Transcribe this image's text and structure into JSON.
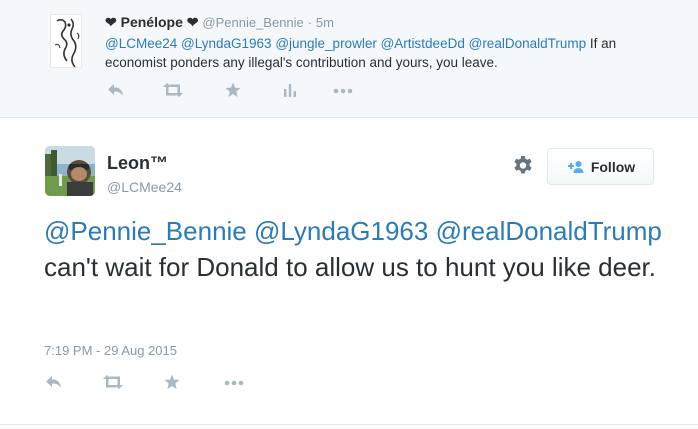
{
  "parent_tweet": {
    "name": "Penélope",
    "heart_glyph": "❤",
    "handle": "@Pennie_Bennie",
    "separator": "·",
    "time": "5m",
    "mentions": [
      "@LCMee24",
      "@LyndaG1963",
      "@jungle_prowler",
      "@ArtistdeeDd",
      "@realDonaldTrump"
    ],
    "text": "If an economist ponders any illegal's contribution and yours, you leave.",
    "actions": [
      "reply-icon",
      "retweet-icon",
      "favorite-icon",
      "analytics-icon",
      "more-icon"
    ]
  },
  "main_tweet": {
    "name": "Leon™",
    "handle": "@LCMee24",
    "follow_label": "Follow",
    "mentions": [
      "@Pennie_Bennie",
      "@LyndaG1963",
      "@realDonaldTrump"
    ],
    "text": "can't wait for Donald to allow us to hunt you like deer.",
    "timestamp": "7:19 PM - 29 Aug 2015",
    "actions": [
      "reply-icon",
      "retweet-icon",
      "favorite-icon",
      "more-icon"
    ]
  },
  "colors": {
    "link": "#2b7bb9",
    "muted": "#8899a6",
    "icon": "#aab8c2",
    "parent_bg": "#f5f8fa",
    "follow_icon": "#55acee"
  }
}
